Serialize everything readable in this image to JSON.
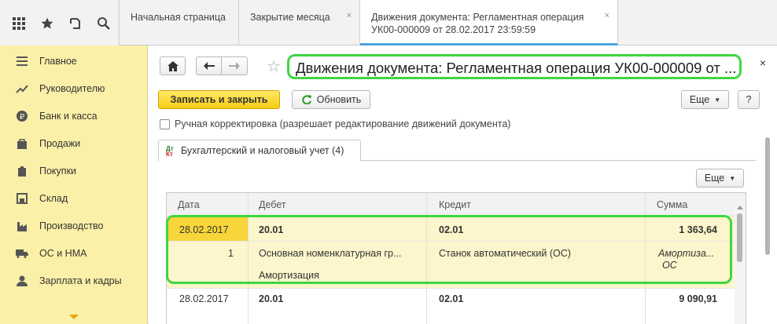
{
  "topbar": {
    "icons": [
      "apps-grid-icon",
      "star-icon",
      "history-icon",
      "search-icon"
    ],
    "tabs": [
      {
        "label": "Начальная страница"
      },
      {
        "label": "Закрытие месяца",
        "close": "×"
      },
      {
        "label_line1": "Движения документа: Регламентная операция",
        "label_line2": "УК00-000009 от 28.02.2017 23:59:59",
        "close": "×"
      }
    ]
  },
  "sidebar": {
    "items": [
      {
        "label": "Главное",
        "icon": "menu-icon"
      },
      {
        "label": "Руководителю",
        "icon": "trend-icon"
      },
      {
        "label": "Банк и касса",
        "icon": "ruble-icon"
      },
      {
        "label": "Продажи",
        "icon": "bag-icon"
      },
      {
        "label": "Покупки",
        "icon": "cart-icon"
      },
      {
        "label": "Склад",
        "icon": "warehouse-icon"
      },
      {
        "label": "Производство",
        "icon": "factory-icon"
      },
      {
        "label": "ОС и НМА",
        "icon": "truck-icon"
      },
      {
        "label": "Зарплата и кадры",
        "icon": "person-icon"
      }
    ]
  },
  "main": {
    "title": "Движения документа: Регламентная операция УК00-000009 от ...",
    "close": "×",
    "toolbar": {
      "save_close": "Записать и закрыть",
      "refresh": "Обновить",
      "more": "Еще",
      "help": "?"
    },
    "checkbox_label": "Ручная корректировка (разрешает редактирование движений документа)",
    "tab": {
      "label": "Бухгалтерский и налоговый учет (4)",
      "icon_top": "Дт",
      "icon_bottom": "Кт"
    },
    "table_more": "Еще",
    "table": {
      "headers": [
        "Дата",
        "Дебет",
        "Кредит",
        "Сумма"
      ],
      "rows": [
        {
          "date": "28.02.2017",
          "num": "1",
          "debit_account": "20.01",
          "debit_sub1": "Основная номенклатурная гр...",
          "debit_sub2": "Амортизация",
          "credit_account": "02.01",
          "credit_sub1": "Станок автоматический (ОС)",
          "amount": "1 363,64",
          "amount_note1": "Амортиза...",
          "amount_note2": "ОС"
        },
        {
          "date": "28.02.2017",
          "debit_account": "20.01",
          "credit_account": "02.01",
          "amount": "9 090,91"
        }
      ]
    }
  }
}
